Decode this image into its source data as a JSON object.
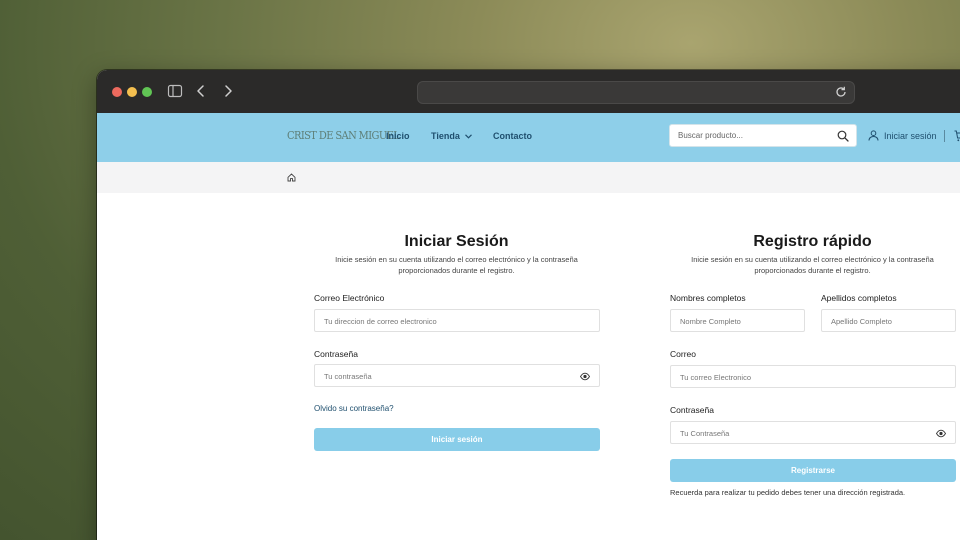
{
  "header": {
    "logo": "CRIST DE SAN MIGUEL",
    "nav": {
      "inicio": "Inicio",
      "tienda": "Tienda",
      "contacto": "Contacto"
    },
    "search_placeholder": "Buscar producto...",
    "login": "Iniciar sesión"
  },
  "login": {
    "title": "Iniciar Sesión",
    "subtitle_line1": "Inicie sesión en su cuenta utilizando el correo electrónico y la contraseña",
    "subtitle_line2": "proporcionados durante el registro.",
    "email_label": "Correo Electrónico",
    "email_placeholder": "Tu direccion de correo electronico",
    "password_label": "Contraseña",
    "password_placeholder": "Tu contraseña",
    "forgot_link": "Olvido su contraseña?",
    "submit": "Iniciar sesión"
  },
  "register": {
    "title": "Registro rápido",
    "subtitle_line1": "Inicie sesión en su cuenta utilizando el correo electrónico y la contraseña",
    "subtitle_line2": "proporcionados durante el registro.",
    "names_label": "Nombres completos",
    "names_placeholder": "Nombre Completo",
    "surnames_label": "Apellidos completos",
    "surnames_placeholder": "Apellido Completo",
    "email_label": "Correo",
    "email_placeholder": "Tu correo Electronico",
    "password_label": "Contraseña",
    "password_placeholder": "Tu Contraseña",
    "submit": "Registrarse",
    "note": "Recuerda para realizar tu pedido debes tener una dirección registrada."
  },
  "colors": {
    "header_bg": "#8ecfe9",
    "button_bg": "#88cde9",
    "link": "#1f4f6e"
  }
}
